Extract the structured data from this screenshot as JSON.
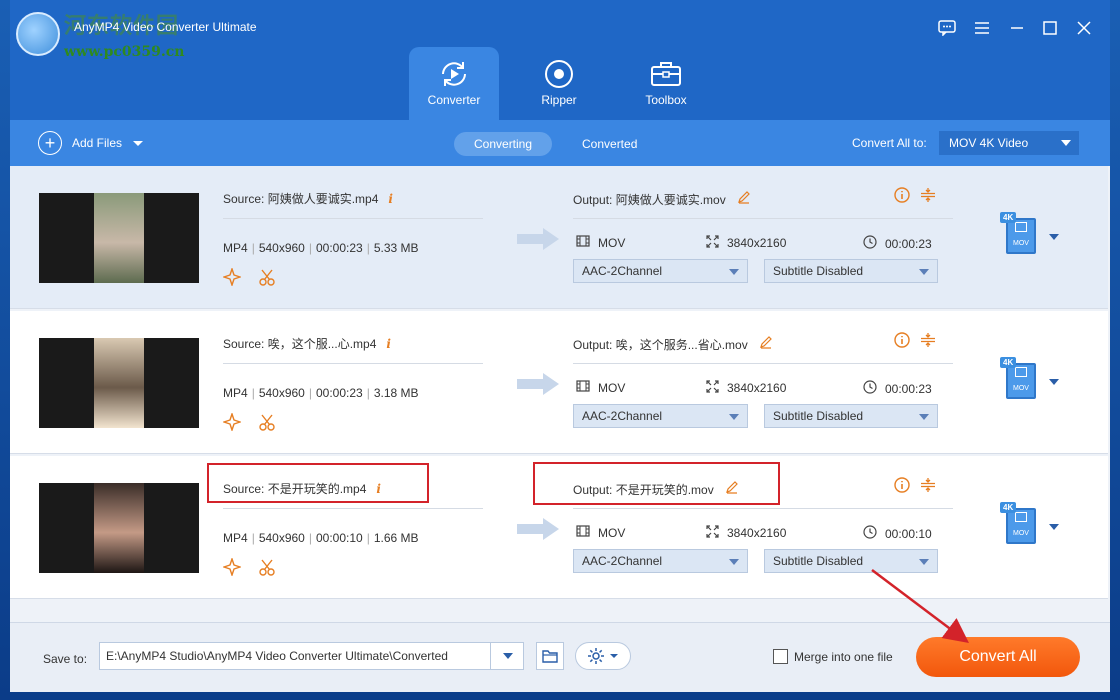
{
  "app": {
    "title": "AnyMP4 Video Converter Ultimate"
  },
  "watermark": {
    "site_text": "河东软件园",
    "url": "www.pc0359.cn"
  },
  "nav": {
    "tabs": [
      {
        "label": "Converter",
        "active": true,
        "icon": "converter-icon"
      },
      {
        "label": "Ripper",
        "active": false,
        "icon": "disc-icon"
      },
      {
        "label": "Toolbox",
        "active": false,
        "icon": "toolbox-icon"
      }
    ]
  },
  "toolbar": {
    "add_files": "Add Files",
    "segments": [
      "Converting",
      "Converted"
    ],
    "active_segment": "Converting",
    "convert_all_to_label": "Convert All to:",
    "convert_all_to_value": "MOV 4K Video"
  },
  "files": [
    {
      "source": "Source: 阿姨做人要诚实.mp4",
      "meta": [
        "MP4",
        "540x960",
        "00:00:23",
        "5.33 MB"
      ],
      "output": "Output: 阿姨做人要诚实.mov",
      "out_format": "MOV",
      "out_resolution": "3840x2160",
      "out_duration": "00:00:23",
      "audio": "AAC-2Channel",
      "subtitle": "Subtitle Disabled",
      "badge_top": "4K",
      "badge_bottom": "MOV"
    },
    {
      "source": "Source: 唉，这个服...心.mp4",
      "meta": [
        "MP4",
        "540x960",
        "00:00:23",
        "3.18 MB"
      ],
      "output": "Output: 唉，这个服务...省心.mov",
      "out_format": "MOV",
      "out_resolution": "3840x2160",
      "out_duration": "00:00:23",
      "audio": "AAC-2Channel",
      "subtitle": "Subtitle Disabled",
      "badge_top": "4K",
      "badge_bottom": "MOV"
    },
    {
      "source": "Source: 不是开玩笑的.mp4",
      "meta": [
        "MP4",
        "540x960",
        "00:00:10",
        "1.66 MB"
      ],
      "output": "Output: 不是开玩笑的.mov",
      "out_format": "MOV",
      "out_resolution": "3840x2160",
      "out_duration": "00:00:10",
      "audio": "AAC-2Channel",
      "subtitle": "Subtitle Disabled",
      "badge_top": "4K",
      "badge_bottom": "MOV"
    }
  ],
  "bottom": {
    "save_to_label": "Save to:",
    "save_path": "E:\\AnyMP4 Studio\\AnyMP4 Video Converter Ultimate\\Converted",
    "merge_label": "Merge into one file",
    "merge_checked": false,
    "convert_all": "Convert All"
  },
  "colors": {
    "accent": "#1f67c6",
    "toolbar": "#3a86e2",
    "orange": "#f2570c",
    "annotation_red": "#d3232a"
  }
}
